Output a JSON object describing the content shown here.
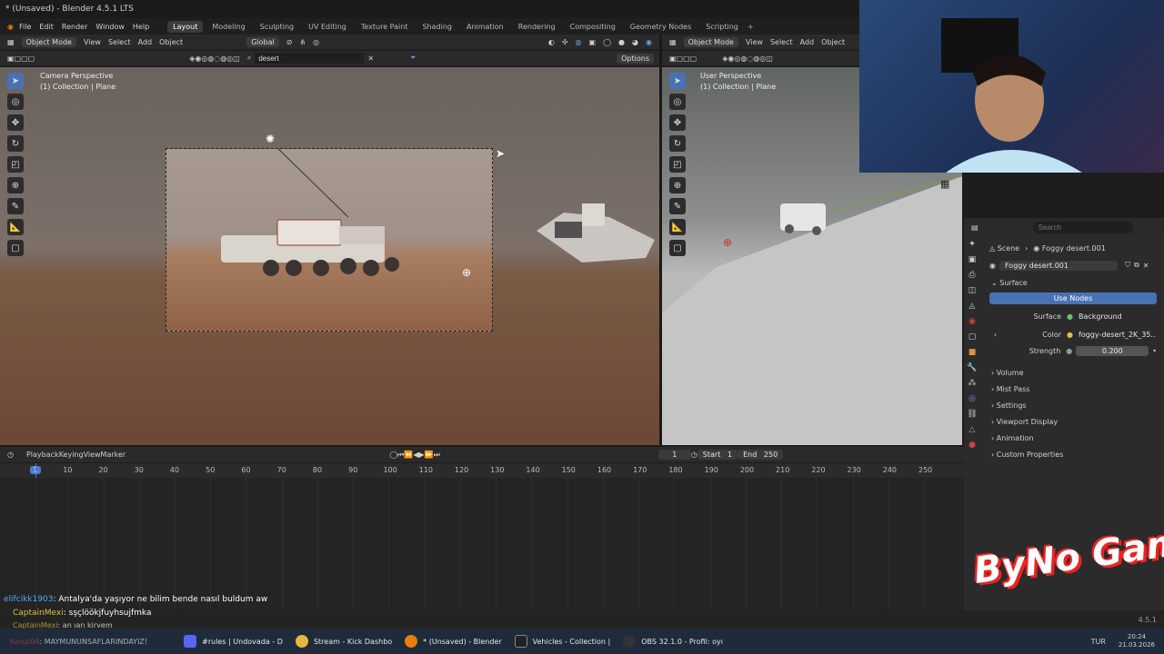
{
  "titlebar": {
    "title": "* (Unsaved) - Blender 4.5.1 LTS"
  },
  "menu": {
    "items": [
      "File",
      "Edit",
      "Render",
      "Window",
      "Help"
    ],
    "workspaces": [
      "Layout",
      "Modeling",
      "Sculpting",
      "UV Editing",
      "Texture Paint",
      "Shading",
      "Animation",
      "Rendering",
      "Compositing",
      "Geometry Nodes",
      "Scripting"
    ],
    "active_workspace": "Layout"
  },
  "viewport_left": {
    "mode": "Object Mode",
    "menus": [
      "View",
      "Select",
      "Add",
      "Object"
    ],
    "transform": "Global",
    "search": "desert",
    "options": "Options",
    "overlay_title": "Camera Perspective",
    "overlay_sub": "(1) Collection | Plane"
  },
  "viewport_right": {
    "mode": "Object Mode",
    "menus": [
      "View",
      "Select",
      "Add",
      "Object"
    ],
    "overlay_title": "User Perspective",
    "overlay_sub": "(1) Collection | Plane"
  },
  "timeline": {
    "menus": [
      "Playback",
      "Keying",
      "View",
      "Marker"
    ],
    "current_frame": "1",
    "start_label": "Start",
    "start": "1",
    "end_label": "End",
    "end": "250",
    "ticks": [
      "1",
      "10",
      "20",
      "30",
      "40",
      "50",
      "60",
      "70",
      "80",
      "90",
      "100",
      "110",
      "120",
      "130",
      "140",
      "150",
      "160",
      "170",
      "180",
      "190",
      "200",
      "210",
      "220",
      "230",
      "240",
      "250"
    ]
  },
  "properties": {
    "search_placeholder": "Search",
    "breadcrumb_scene": "Scene",
    "breadcrumb_world": "Foggy desert.001",
    "world_name": "Foggy desert.001",
    "surface_panel": "Surface",
    "use_nodes": "Use Nodes",
    "surface_label": "Surface",
    "surface_value": "Background",
    "color_label": "Color",
    "color_value": "foggy-desert_2K_35...",
    "strength_label": "Strength",
    "strength_value": "0.200",
    "panels": [
      "Volume",
      "Mist Pass",
      "Settings",
      "Viewport Display",
      "Animation",
      "Custom Properties"
    ]
  },
  "chat": {
    "lines": [
      {
        "user": "elifcikk1903",
        "text": ": Antalya'da yaşıyor ne bilim bende nasıl buldum aw",
        "color": "#4fa6ff"
      },
      {
        "user": "CaptainMexi",
        "text": ": sşçlöökjfuyhsujfmka",
        "color": "#e0c040"
      },
      {
        "user": "CaptainMexi",
        "text": ": an ıan kirvem",
        "color": "#e0c040"
      },
      {
        "user": "Yunus04",
        "text": ": MAYMUNUNSAFLARINDAYIZ!",
        "color": "#e04040"
      }
    ]
  },
  "version": "4.5.1",
  "overlay_logo": "ByNo Gam",
  "taskbar": {
    "apps": [
      "#rules | Undovada - D",
      "Stream - Kick Dashbo",
      "* (Unsaved) - Blender",
      "Vehicles - Collection |",
      "OBS 32.1.0 - Profil: oyı"
    ],
    "lang": "TUR",
    "time": "20:24",
    "date": "21.03.2026"
  },
  "colors": {
    "accent": "#4772b3",
    "timeline_cursor": "#4a7fd0"
  }
}
